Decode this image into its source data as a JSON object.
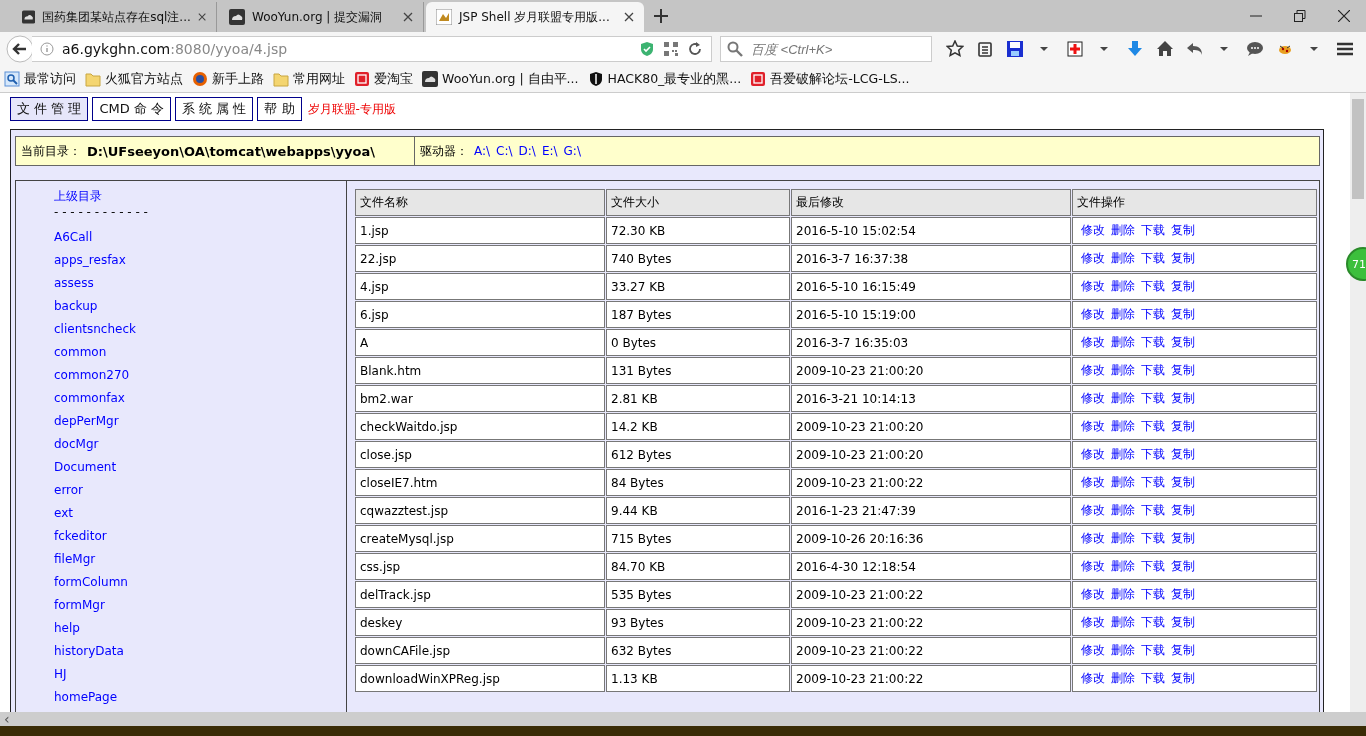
{
  "browser": {
    "tabs": [
      {
        "title": "国药集团某站点存在sql注...",
        "selected": false
      },
      {
        "title": "WooYun.org | 提交漏洞",
        "selected": false
      },
      {
        "title": "JSP Shell 岁月联盟专用版...",
        "selected": true
      }
    ],
    "url": {
      "host": "a6.gykghn.com",
      "rest": ":8080/yyoa/4.jsp"
    },
    "search_placeholder": "百度 <Ctrl+K>",
    "bookmarks": [
      {
        "label": "最常访问",
        "kind": "search"
      },
      {
        "label": "火狐官方站点",
        "kind": "folder"
      },
      {
        "label": "新手上路",
        "kind": "globe"
      },
      {
        "label": "常用网址",
        "kind": "folder"
      },
      {
        "label": "爱淘宝",
        "kind": "red"
      },
      {
        "label": "WooYun.org | 自由平...",
        "kind": "dark"
      },
      {
        "label": "HACK80_最专业的黑...",
        "kind": "shield"
      },
      {
        "label": "吾爱破解论坛-LCG-LS...",
        "kind": "red"
      }
    ],
    "side_badge": "71"
  },
  "shell": {
    "nav_buttons": [
      {
        "label": "文 件 管 理",
        "selected": true
      },
      {
        "label": "CMD 命 令",
        "selected": false
      },
      {
        "label": "系 统 属 性",
        "selected": false
      },
      {
        "label": "帮 助",
        "selected": false
      }
    ],
    "brand": "岁月联盟-专用版",
    "current_dir": {
      "label": "当前目录：",
      "value": "D:\\UFseeyon\\OA\\tomcat\\webapps\\yyoa\\"
    },
    "drives": {
      "label": "驱动器：",
      "items": [
        "A:\\",
        "C:\\",
        "D:\\",
        "E:\\",
        "G:\\"
      ]
    },
    "parent_link": "上级目录",
    "separator": "- - - - - - - - - - - -",
    "dirs": [
      "A6Call",
      "apps_resfax",
      "assess",
      "backup",
      "clientsncheck",
      "common",
      "common270",
      "commonfax",
      "depPerMgr",
      "docMgr",
      "Document",
      "error",
      "ext",
      "fckeditor",
      "fileMgr",
      "formColumn",
      "formMgr",
      "help",
      "historyData",
      "HJ",
      "homePage"
    ],
    "table": {
      "columns": [
        "文件名称",
        "文件大小",
        "最后修改",
        "文件操作"
      ],
      "scrollbar_arrow": "‹",
      "rows": [
        [
          "1.jsp",
          "72.30 KB",
          "2016-5-10 15:02:54",
          "修改",
          "删除",
          "下载",
          "复制"
        ],
        [
          "22.jsp",
          "740 Bytes",
          "2016-3-7 16:37:38",
          "修改",
          "删除",
          "下载",
          "复制"
        ],
        [
          "4.jsp",
          "33.27 KB",
          "2016-5-10 16:15:49",
          "修改",
          "删除",
          "下载",
          "复制"
        ],
        [
          "6.jsp",
          "187 Bytes",
          "2016-5-10 15:19:00",
          "修改",
          "删除",
          "下载",
          "复制"
        ],
        [
          "A",
          "0 Bytes",
          "2016-3-7 16:35:03",
          "修改",
          "删除",
          "下载",
          "复制"
        ],
        [
          "Blank.htm",
          "131 Bytes",
          "2009-10-23 21:00:20",
          "修改",
          "删除",
          "下载",
          "复制"
        ],
        [
          "bm2.war",
          "2.81 KB",
          "2016-3-21 10:14:13",
          "修改",
          "删除",
          "下载",
          "复制"
        ],
        [
          "checkWaitdo.jsp",
          "14.2 KB",
          "2009-10-23 21:00:20",
          "修改",
          "删除",
          "下载",
          "复制"
        ],
        [
          "close.jsp",
          "612 Bytes",
          "2009-10-23 21:00:20",
          "修改",
          "删除",
          "下载",
          "复制"
        ],
        [
          "closeIE7.htm",
          "84 Bytes",
          "2009-10-23 21:00:22",
          "修改",
          "删除",
          "下载",
          "复制"
        ],
        [
          "cqwazztest.jsp",
          "9.44 KB",
          "2016-1-23 21:47:39",
          "修改",
          "删除",
          "下载",
          "复制"
        ],
        [
          "createMysql.jsp",
          "715 Bytes",
          "2009-10-26 20:16:36",
          "修改",
          "删除",
          "下载",
          "复制"
        ],
        [
          "css.jsp",
          "84.70 KB",
          "2016-4-30 12:18:54",
          "修改",
          "删除",
          "下载",
          "复制"
        ],
        [
          "delTrack.jsp",
          "535 Bytes",
          "2009-10-23 21:00:22",
          "修改",
          "删除",
          "下载",
          "复制"
        ],
        [
          "deskey",
          "93 Bytes",
          "2009-10-23 21:00:22",
          "修改",
          "删除",
          "下载",
          "复制"
        ],
        [
          "downCAFile.jsp",
          "632 Bytes",
          "2009-10-23 21:00:22",
          "修改",
          "删除",
          "下载",
          "复制"
        ],
        [
          "downloadWinXPReg.jsp",
          "1.13 KB",
          "2009-10-23 21:00:22",
          "修改",
          "删除",
          "下载",
          "复制"
        ]
      ]
    }
  }
}
